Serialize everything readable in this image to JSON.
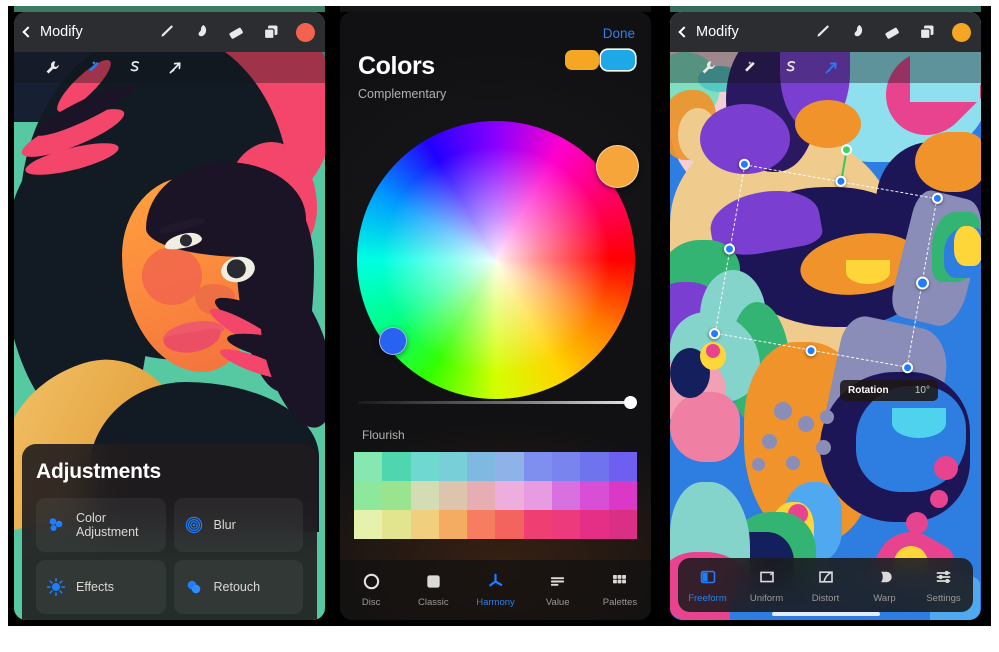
{
  "panels": {
    "left": {
      "navbar": {
        "back_label": "Modify",
        "back_icon": "chevron-left-icon"
      },
      "tools": [
        {
          "name": "brush-icon"
        },
        {
          "name": "smudge-icon"
        },
        {
          "name": "eraser-icon"
        },
        {
          "name": "layers-icon"
        },
        {
          "name": "color-swatch",
          "color": "#f2634f"
        }
      ],
      "subtools": [
        {
          "name": "wrench-icon",
          "active": false
        },
        {
          "name": "magic-wand-icon",
          "active": true
        },
        {
          "name": "selection-icon",
          "active": false
        },
        {
          "name": "transform-arrow-icon",
          "active": false
        }
      ],
      "sheet": {
        "title": "Adjustments",
        "items": [
          {
            "label": "Color Adjustment",
            "icon": "color-adjust-icon"
          },
          {
            "label": "Blur",
            "icon": "blur-icon"
          },
          {
            "label": "Effects",
            "icon": "effects-icon"
          },
          {
            "label": "Retouch",
            "icon": "retouch-icon"
          }
        ]
      }
    },
    "middle": {
      "done_label": "Done",
      "title": "Colors",
      "subtitle": "Complementary",
      "swatches": [
        {
          "color": "#f5a623",
          "selected": false
        },
        {
          "color": "#1fa8e8",
          "selected": true
        }
      ],
      "wheel": {
        "handles": [
          {
            "name": "primary-color-handle",
            "color": "#f5a53a"
          },
          {
            "name": "secondary-color-handle",
            "color": "#2862f0"
          }
        ]
      },
      "brightness_slider": {
        "value": 100
      },
      "palette_label": "Flourish",
      "palette_colors": [
        "#86e8b0",
        "#4fd6ae",
        "#6fd9cf",
        "#79cfd7",
        "#7fb8e0",
        "#8fb3e8",
        "#7f8ff0",
        "#7a84ef",
        "#6f73ec",
        "#6f5ff0",
        "#8ee89c",
        "#9ae490",
        "#d4dcb4",
        "#ddc4ad",
        "#e6aeb2",
        "#eeaedd",
        "#e79be0",
        "#d870e0",
        "#d84fd6",
        "#d939c6",
        "#e6f2ab",
        "#e2e58e",
        "#f0cf7e",
        "#f4ab62",
        "#f77d60",
        "#f4645f",
        "#ef3f72",
        "#ec3a7c",
        "#e52f86",
        "#d92f84"
      ],
      "tabs": [
        {
          "label": "Disc",
          "icon": "disc-icon",
          "active": false
        },
        {
          "label": "Classic",
          "icon": "classic-icon",
          "active": false
        },
        {
          "label": "Harmony",
          "icon": "harmony-icon",
          "active": true
        },
        {
          "label": "Value",
          "icon": "value-icon",
          "active": false
        },
        {
          "label": "Palettes",
          "icon": "palettes-icon",
          "active": false
        }
      ]
    },
    "right": {
      "navbar": {
        "back_label": "Modify",
        "back_icon": "chevron-left-icon"
      },
      "tools": [
        {
          "name": "brush-icon"
        },
        {
          "name": "smudge-icon"
        },
        {
          "name": "eraser-icon"
        },
        {
          "name": "layers-icon"
        },
        {
          "name": "color-swatch",
          "color": "#f5a623"
        }
      ],
      "subtools": [
        {
          "name": "wrench-icon",
          "active": false
        },
        {
          "name": "magic-wand-icon",
          "active": false
        },
        {
          "name": "selection-icon",
          "active": false
        },
        {
          "name": "transform-arrow-icon",
          "active": true
        }
      ],
      "rotation_badge": {
        "label": "Rotation",
        "value": "10°"
      },
      "tabs": [
        {
          "label": "Freeform",
          "icon": "freeform-icon",
          "active": true
        },
        {
          "label": "Uniform",
          "icon": "uniform-icon",
          "active": false
        },
        {
          "label": "Distort",
          "icon": "distort-icon",
          "active": false
        },
        {
          "label": "Warp",
          "icon": "warp-icon",
          "active": false
        },
        {
          "label": "Settings",
          "icon": "settings-sliders-icon",
          "active": false
        }
      ]
    }
  }
}
